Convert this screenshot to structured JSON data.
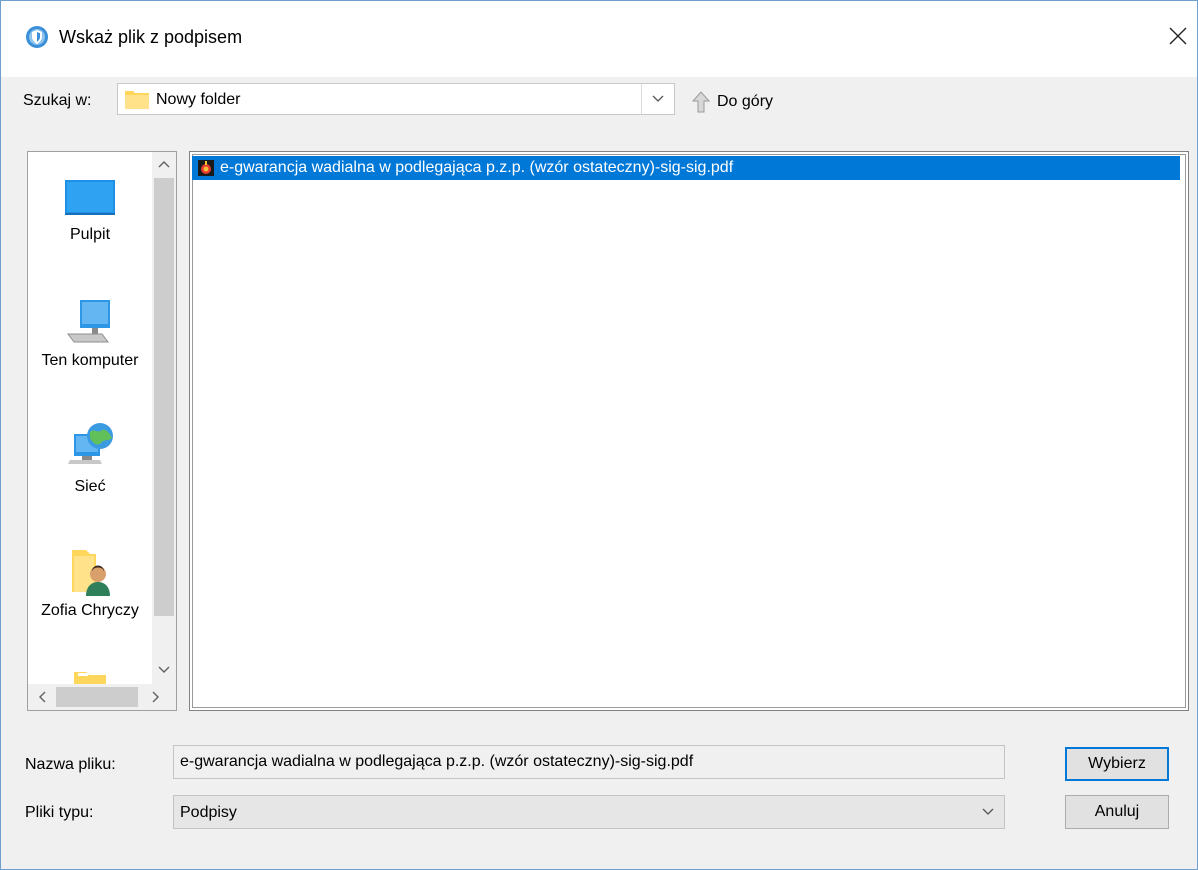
{
  "window": {
    "title": "Wskaż plik z podpisem",
    "icon": "shield-app-icon",
    "close_icon": "close-icon"
  },
  "toolbar": {
    "look_in_label": "Szukaj w:",
    "look_in_value": "Nowy folder",
    "up_label": "Do góry"
  },
  "places": {
    "items": [
      {
        "label": "Pulpit",
        "icon": "desktop-icon"
      },
      {
        "label": "Ten komputer",
        "icon": "computer-icon"
      },
      {
        "label": "Sieć",
        "icon": "network-icon"
      },
      {
        "label": "Zofia Chryczy",
        "icon": "user-folder-icon"
      },
      {
        "label": "",
        "icon": "folder-icon"
      }
    ]
  },
  "files": {
    "items": [
      {
        "name": "e-gwarancja wadialna w podlegająca p.z.p. (wzór ostateczny)-sig-sig.pdf",
        "selected": true,
        "icon": "signed-file-icon"
      }
    ]
  },
  "form": {
    "file_name_label": "Nazwa pliku:",
    "file_name_value": "e-gwarancja wadialna w podlegająca p.z.p. (wzór ostateczny)-sig-sig.pdf",
    "file_type_label": "Pliki typu:",
    "file_type_value": "Podpisy"
  },
  "buttons": {
    "ok": "Wybierz",
    "cancel": "Anuluj"
  },
  "colors": {
    "selection": "#0078d7",
    "window_border": "#6f9fcf"
  }
}
